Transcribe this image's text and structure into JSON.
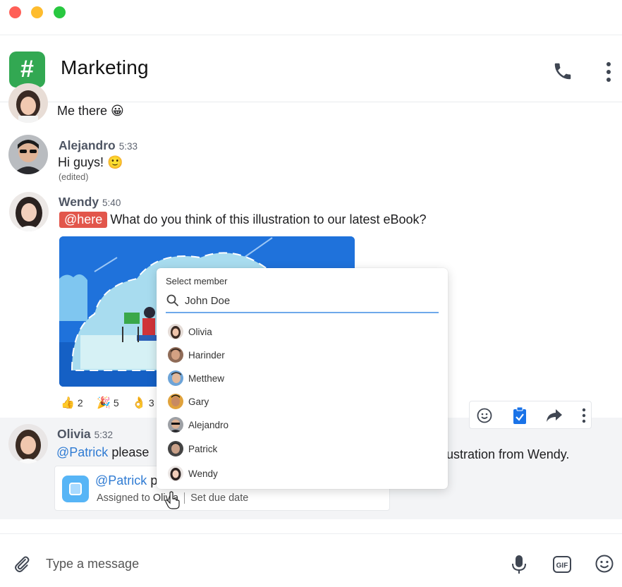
{
  "header": {
    "channel_symbol": "#",
    "channel_name": "Marketing"
  },
  "messages": [
    {
      "author": "",
      "time": "",
      "text": "Me there 😀"
    },
    {
      "author": "Alejandro",
      "time": "5:33",
      "text": "Hi guys! 🙂",
      "edited": "(edited)"
    },
    {
      "author": "Wendy",
      "time": "5:40",
      "mention": "@here",
      "text": "What do you think of this illustration to our latest eBook?",
      "reactions": [
        {
          "emoji": "👍",
          "count": "2"
        },
        {
          "emoji": "🎉",
          "count": "5"
        },
        {
          "emoji": "👌",
          "count": "3"
        }
      ]
    },
    {
      "author": "Olivia",
      "time": "5:32",
      "mention": "@Patrick",
      "text_before_popup": "please",
      "text_after_popup": "ustration from Wendy."
    }
  ],
  "task": {
    "mention": "@Patrick",
    "title_rest": "p",
    "assigned_label": "Assigned to",
    "assignee": "Olivia",
    "due_label": "Set due date"
  },
  "member_picker": {
    "title": "Select member",
    "search_value": "John Doe",
    "members": [
      "Olivia",
      "Harinder",
      "Metthew",
      "Gary",
      "Alejandro",
      "Patrick",
      "Wendy"
    ]
  },
  "composer": {
    "placeholder": "Type a message"
  },
  "colors": {
    "channel_icon": "#32a852",
    "mention_here_bg": "#e2564b",
    "mention_text": "#2f7bd3",
    "task_icon": "#57b5f6",
    "illustration_bg": "#1f72db"
  }
}
